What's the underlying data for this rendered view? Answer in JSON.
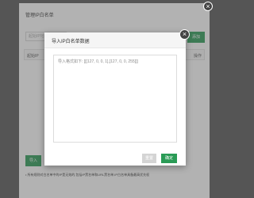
{
  "background_dialog": {
    "title": "管理IP白名单",
    "start_ip_placeholder": "起始IP地址",
    "add_button": "添加",
    "columns": [
      "起始IP",
      "操作"
    ],
    "import_button": "导入",
    "note": "• 所有规则对白名单中的IP是无效的,包括IP黑名单和URL黑名单,IP白名单具备最高优先权"
  },
  "modal": {
    "title": "导入IP白名单数据",
    "textarea_placeholder": "导入格式如下: [[[127, 0, 0, 1],[127, 0, 0, 255]]]",
    "reset_button": "重置",
    "confirm_button": "确定"
  },
  "icons": {
    "close": "close-icon"
  },
  "colors": {
    "primary_green": "#2a9b56",
    "overlay": "#555555",
    "disabled_gray": "#d4d4d4"
  }
}
